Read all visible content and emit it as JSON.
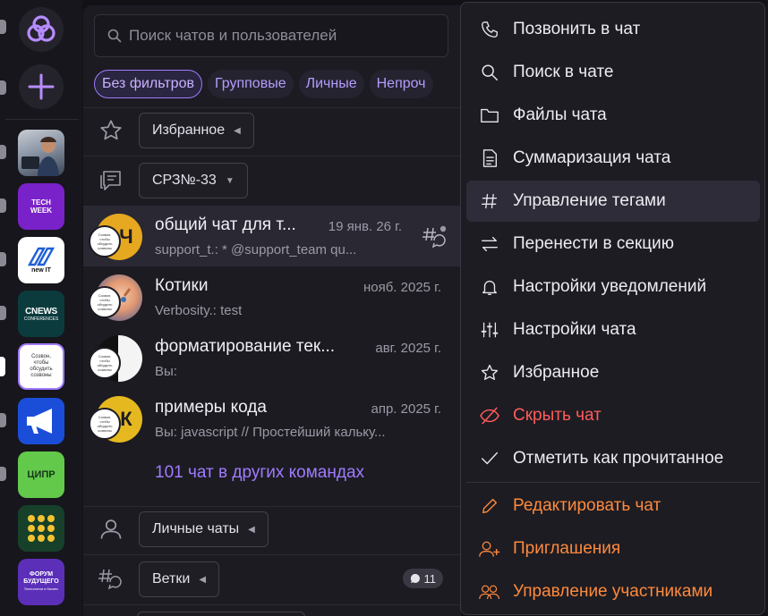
{
  "search": {
    "placeholder": "Поиск чатов и пользователей"
  },
  "filters": [
    "Без фильтров",
    "Групповые",
    "Личные",
    "Непроч"
  ],
  "sections": {
    "favorites": "Избранное",
    "team": "СРЗ№-33",
    "personal": "Личные чаты",
    "threads": "Ветки",
    "threads_count": "11"
  },
  "rail_apps": {
    "tech_week": "TECH WEEK",
    "new_it": "new IT",
    "cnews": "CNEWS",
    "cnews_sub": "CONFERENCES",
    "callout": "Созвон, чтобы обсудить созвоны",
    "cipr": "ЦИПР",
    "forum": "ФОРУМ БУДУЩЕГО",
    "forum_sub": "Технологии и бизнес"
  },
  "chats": [
    {
      "name": "общий чат для т...",
      "date": "19 янв. 26 г.",
      "preview": "support_t.: * @support_team qu...",
      "initial": "Ч"
    },
    {
      "name": "Котики",
      "date": "нояб. 2025 г.",
      "preview": "Verbosity.: test",
      "initial": ""
    },
    {
      "name": "форматирование тек...",
      "date": "авг. 2025 г.",
      "preview": "Вы:",
      "initial": ""
    },
    {
      "name": "примеры кода",
      "date": "апр. 2025 г.",
      "preview": "Вы: javascript // Простейший кальку...",
      "initial": "К"
    }
  ],
  "avatar_badge_text": "Созвон, чтобы обсудить созвоны",
  "more_chats": "101 чат в других командах",
  "menu": [
    "Позвонить в чат",
    "Поиск в чате",
    "Файлы чата",
    "Суммаризация чата",
    "Управление тегами",
    "Перенести в секцию",
    "Настройки уведомлений",
    "Настройки чата",
    "Избранное",
    "Скрыть чат",
    "Отметить как прочитанное",
    "Редактировать чат",
    "Приглашения",
    "Управление участниками"
  ],
  "colors": {
    "accent": "#a07bff",
    "danger": "#ff5c5c",
    "warning": "#ff8a3d",
    "panel": "#1c1b22"
  }
}
